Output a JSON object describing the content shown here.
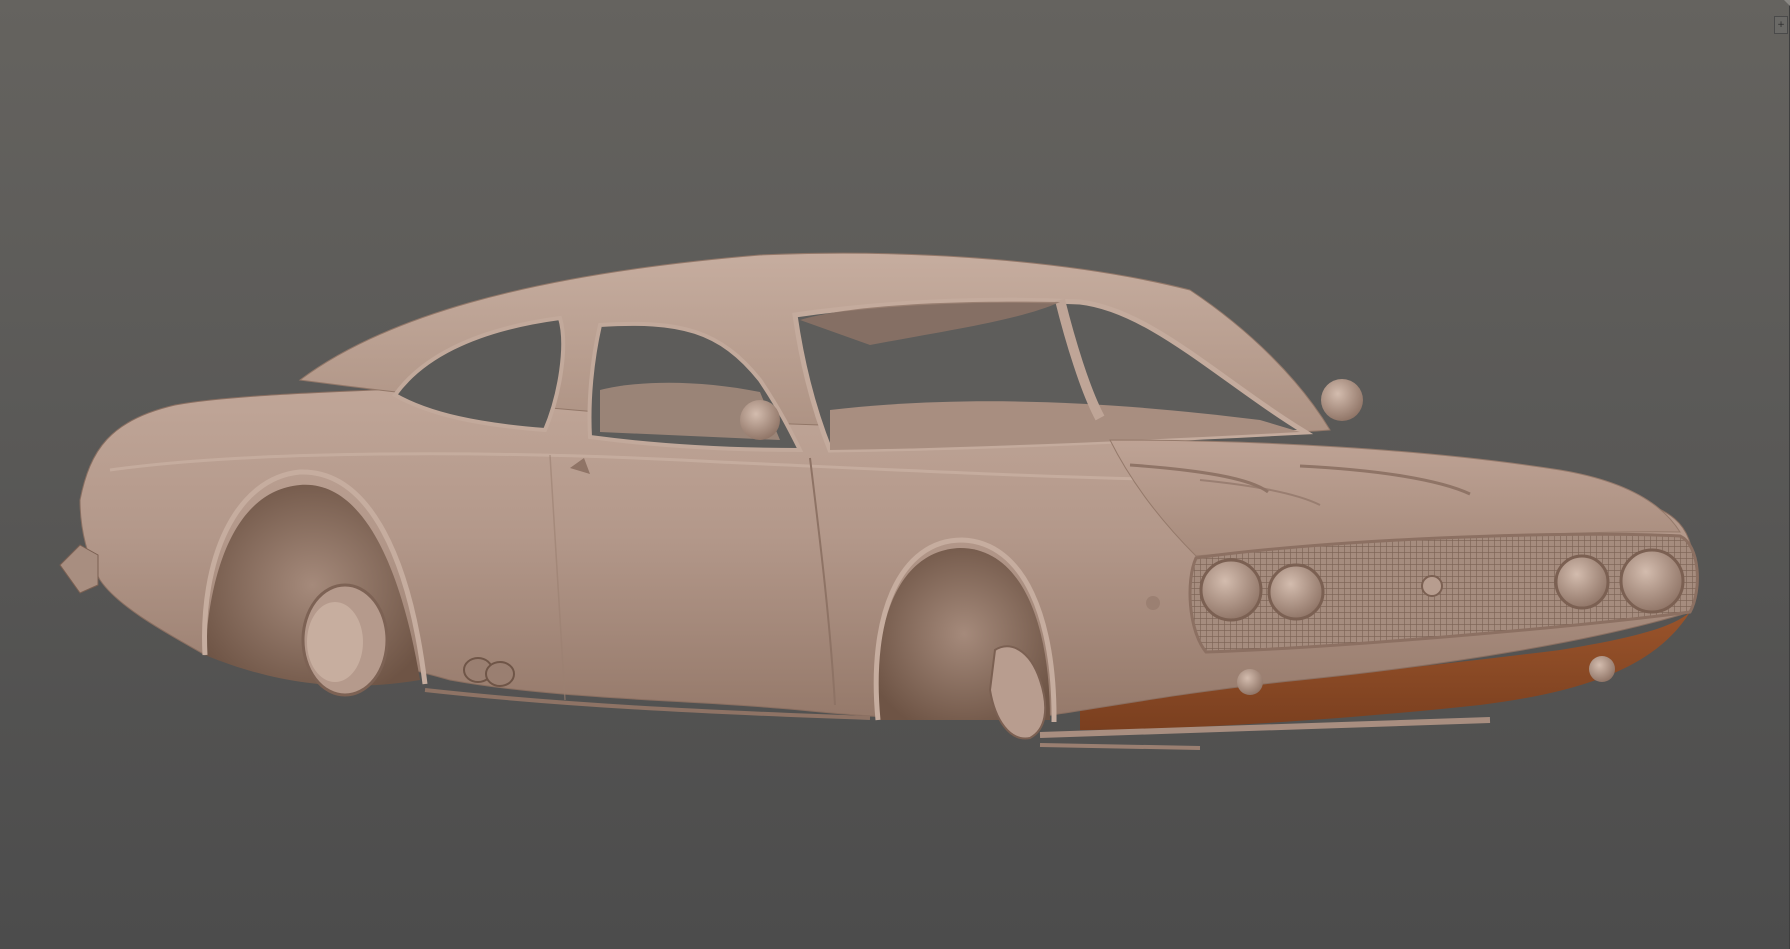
{
  "viewport": {
    "background_top": "#65635f",
    "background_bottom": "#4c4c4c",
    "model_color": "#b3988a",
    "model_shadow": "#7b5c49",
    "underside_color": "#8c4a24"
  },
  "corner_widget": {
    "icon": "plus-icon",
    "glyph": "+"
  }
}
